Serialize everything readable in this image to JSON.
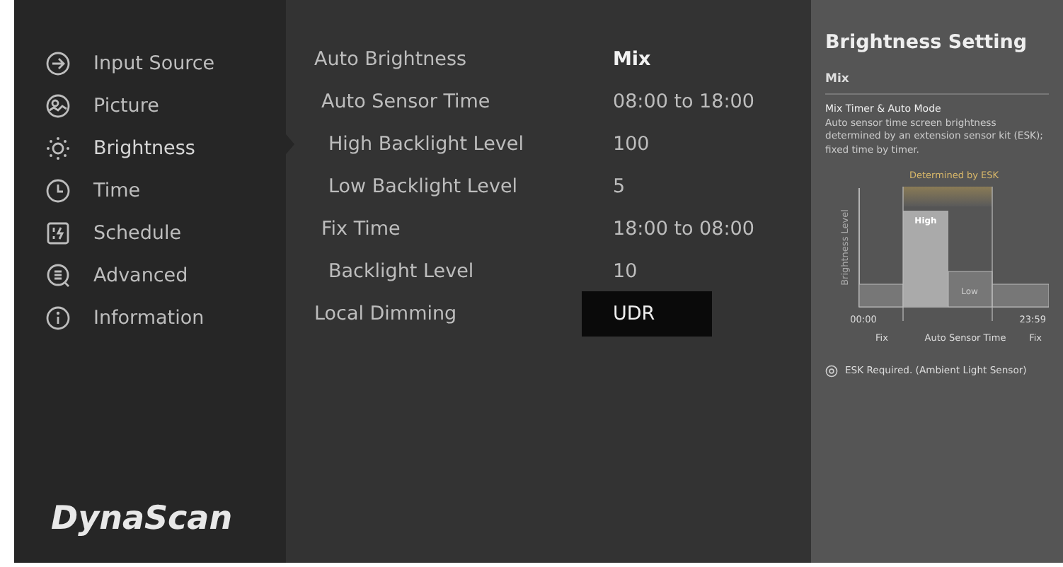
{
  "sidebar": {
    "items": [
      {
        "label": "Input Source",
        "kind": "input",
        "selected": false
      },
      {
        "label": "Picture",
        "kind": "picture",
        "selected": false
      },
      {
        "label": "Brightness",
        "kind": "brightness",
        "selected": true
      },
      {
        "label": "Time",
        "kind": "time",
        "selected": false
      },
      {
        "label": "Schedule",
        "kind": "schedule",
        "selected": false
      },
      {
        "label": "Advanced",
        "kind": "advanced",
        "selected": false
      },
      {
        "label": "Information",
        "kind": "info",
        "selected": false
      }
    ],
    "logo": "DynaScan"
  },
  "settings": [
    {
      "label": "Auto Brightness",
      "value": "Mix",
      "highlighted": true,
      "focused": false,
      "children": [
        {
          "label": "Auto Sensor Time",
          "value": "08:00 to 18:00",
          "highlighted": false,
          "focused": false,
          "children": [
            {
              "label": "High Backlight Level",
              "value": "100",
              "highlighted": false,
              "focused": false
            },
            {
              "label": "Low Backlight Level",
              "value": "5",
              "highlighted": false,
              "focused": false
            }
          ]
        },
        {
          "label": "Fix Time",
          "value": "18:00 to 08:00",
          "highlighted": false,
          "focused": false,
          "children": [
            {
              "label": "Backlight Level",
              "value": "10",
              "highlighted": false,
              "focused": false
            }
          ]
        }
      ]
    },
    {
      "label": "Local Dimming",
      "value": "UDR",
      "highlighted": false,
      "focused": true
    }
  ],
  "help": {
    "title": "Brightness Setting",
    "subtitle": "Mix",
    "heading": "Mix Timer & Auto Mode",
    "description": "Auto sensor time screen brightness determined by an extension sensor kit (ESK); fixed time by timer.",
    "diagram": {
      "top_label": "Determined by ESK",
      "high_label": "High",
      "low_label": "Low",
      "axis_label": "Brightness Level",
      "start_time": "00:00",
      "end_time": "23:59",
      "segments": [
        "Fix",
        "Auto Sensor Time",
        "Fix"
      ]
    },
    "note": "ESK Required. (Ambient Light Sensor)"
  }
}
